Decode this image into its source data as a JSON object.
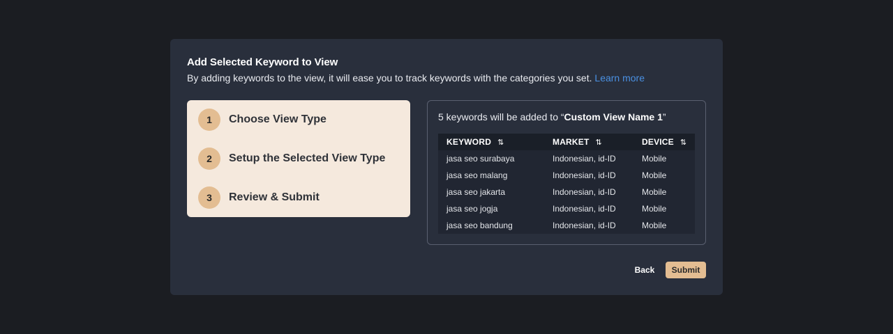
{
  "modal": {
    "title": "Add Selected Keyword to View",
    "description": "By adding keywords to the view, it will ease you to track keywords with the categories you set.",
    "learn_more": "Learn more"
  },
  "steps": [
    {
      "number": "1",
      "label": "Choose View Type"
    },
    {
      "number": "2",
      "label": "Setup the Selected View Type"
    },
    {
      "number": "3",
      "label": "Review & Submit"
    }
  ],
  "preview": {
    "prefix": "5 keywords will be added to “",
    "view_name": "Custom View Name 1",
    "suffix": "”",
    "columns": [
      {
        "label": "KEYWORD",
        "sort_icon": "sort-icon"
      },
      {
        "label": "MARKET",
        "sort_icon": "sort-icon"
      },
      {
        "label": "DEVICE",
        "sort_icon": "sort-icon"
      }
    ],
    "rows": [
      [
        "jasa seo surabaya",
        "Indonesian, id-ID",
        "Mobile"
      ],
      [
        "jasa seo malang",
        "Indonesian, id-ID",
        "Mobile"
      ],
      [
        "jasa seo jakarta",
        "Indonesian, id-ID",
        "Mobile"
      ],
      [
        "jasa seo jogja",
        "Indonesian, id-ID",
        "Mobile"
      ],
      [
        "jasa seo bandung",
        "Indonesian, id-ID",
        "Mobile"
      ]
    ]
  },
  "actions": {
    "back": "Back",
    "submit": "Submit"
  },
  "colors": {
    "accent": "#e3bd92",
    "link": "#4a90e2",
    "modal_bg": "#292f3c",
    "steps_bg": "#f5e9dd"
  }
}
